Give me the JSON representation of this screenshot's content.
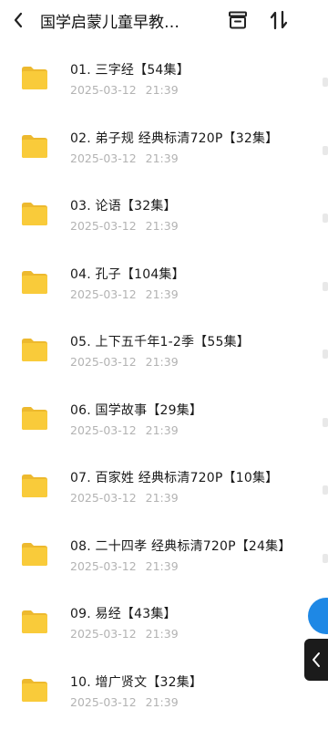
{
  "header": {
    "title": "国学启蒙儿童早教…",
    "back_icon": "chevron-left-icon",
    "box_icon": "archive-box-icon",
    "sort_icon": "sort-arrows-icon"
  },
  "folder_color": "#F9CB3A",
  "items": [
    {
      "name": "01. 三字经【54集】",
      "date": "2025-03-12",
      "time": "21:39"
    },
    {
      "name": "02. 弟子规 经典标清720P【32集】",
      "date": "2025-03-12",
      "time": "21:39"
    },
    {
      "name": "03. 论语【32集】",
      "date": "2025-03-12",
      "time": "21:39"
    },
    {
      "name": "04. 孔子【104集】",
      "date": "2025-03-12",
      "time": "21:39"
    },
    {
      "name": "05. 上下五千年1-2季【55集】",
      "date": "2025-03-12",
      "time": "21:39"
    },
    {
      "name": "06. 国学故事【29集】",
      "date": "2025-03-12",
      "time": "21:39"
    },
    {
      "name": "07. 百家姓 经典标清720P【10集】",
      "date": "2025-03-12",
      "time": "21:39"
    },
    {
      "name": "08. 二十四孝 经典标清720P【24集】",
      "date": "2025-03-12",
      "time": "21:39"
    },
    {
      "name": "09. 易经【43集】",
      "date": "2025-03-12",
      "time": "21:39"
    },
    {
      "name": "10. 增广贤文【32集】",
      "date": "2025-03-12",
      "time": "21:39"
    }
  ],
  "side_tab_icon": "chevron-left-icon"
}
